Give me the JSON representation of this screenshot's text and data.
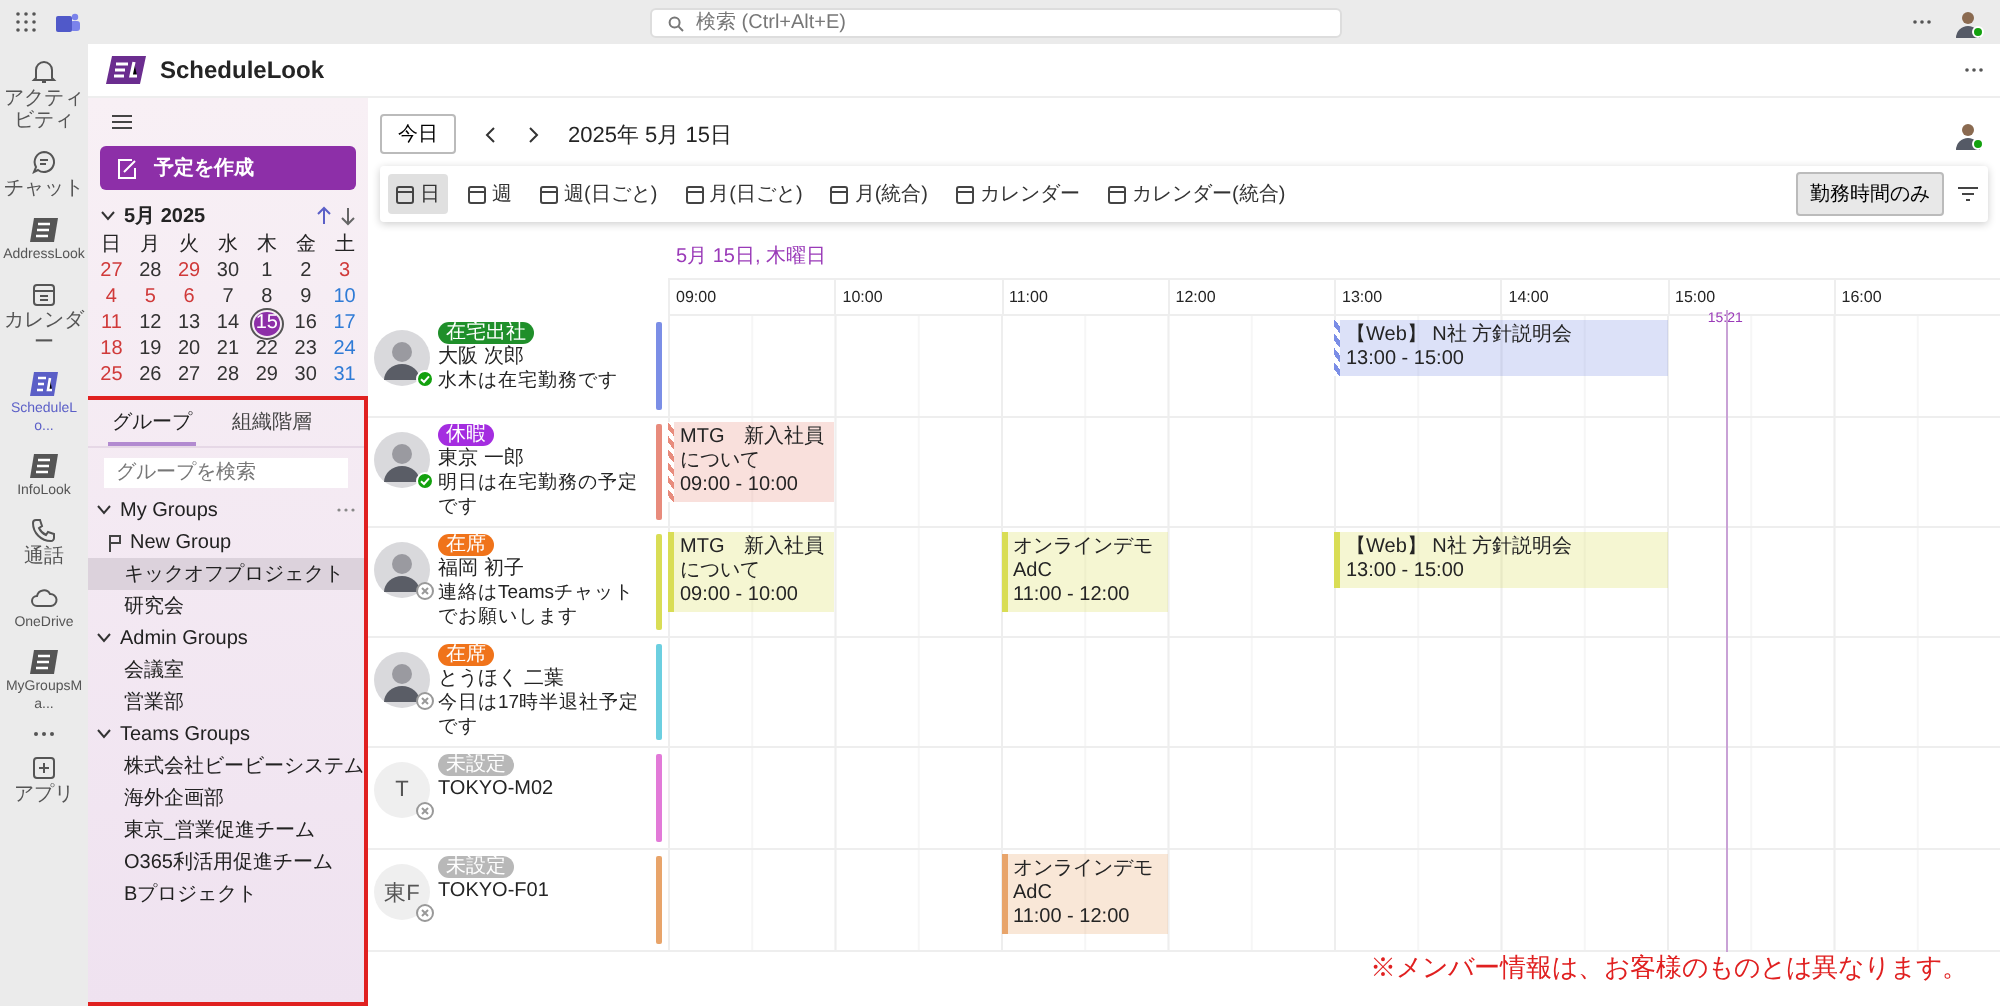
{
  "top_bar": {
    "search": {
      "placeholder": "検索 (Ctrl+Alt+E)"
    }
  },
  "app_rail": [
    {
      "label": "アクティビティ",
      "kind": "bell",
      "selected": false
    },
    {
      "label": "チャット",
      "kind": "chat",
      "selected": false
    },
    {
      "label": "AddressLook",
      "kind": "addresslook",
      "selected": false
    },
    {
      "label": "カレンダー",
      "kind": "calendar",
      "selected": false
    },
    {
      "label": "ScheduleLo...",
      "kind": "schedulelook",
      "selected": true
    },
    {
      "label": "InfoLook",
      "kind": "infolook",
      "selected": false
    },
    {
      "label": "通話",
      "kind": "phone",
      "selected": false
    },
    {
      "label": "OneDrive",
      "kind": "cloud",
      "selected": false
    },
    {
      "label": "MyGroupsMa...",
      "kind": "mygroups",
      "selected": false
    },
    {
      "kind": "more",
      "selected": false
    },
    {
      "label": "アプリ",
      "kind": "apps",
      "selected": false
    }
  ],
  "app": {
    "name": "ScheduleLook"
  },
  "sidebar": {
    "create_button": "予定を作成",
    "mini_calendar": {
      "title": "5月 2025",
      "weekdays": [
        "日",
        "月",
        "火",
        "水",
        "木",
        "金",
        "土"
      ],
      "weeks": [
        [
          {
            "day": "27",
            "kind": "sunday",
            "selected": false
          },
          {
            "day": "28",
            "kind": "weekday",
            "selected": false
          },
          {
            "day": "29",
            "kind": "holiday",
            "selected": false
          },
          {
            "day": "30",
            "kind": "weekday",
            "selected": false
          },
          {
            "day": "1",
            "kind": "weekday",
            "selected": false
          },
          {
            "day": "2",
            "kind": "weekday",
            "selected": false
          },
          {
            "day": "3",
            "kind": "holiday",
            "selected": false
          }
        ],
        [
          {
            "day": "4",
            "kind": "sunday",
            "selected": false
          },
          {
            "day": "5",
            "kind": "holiday",
            "selected": false
          },
          {
            "day": "6",
            "kind": "holiday",
            "selected": false
          },
          {
            "day": "7",
            "kind": "weekday",
            "selected": false
          },
          {
            "day": "8",
            "kind": "weekday",
            "selected": false
          },
          {
            "day": "9",
            "kind": "weekday",
            "selected": false
          },
          {
            "day": "10",
            "kind": "saturday",
            "selected": false
          }
        ],
        [
          {
            "day": "11",
            "kind": "sunday",
            "selected": false
          },
          {
            "day": "12",
            "kind": "weekday",
            "selected": false
          },
          {
            "day": "13",
            "kind": "weekday",
            "selected": false
          },
          {
            "day": "14",
            "kind": "weekday",
            "selected": false
          },
          {
            "day": "15",
            "kind": "weekday",
            "selected": true
          },
          {
            "day": "16",
            "kind": "weekday",
            "selected": false
          },
          {
            "day": "17",
            "kind": "saturday",
            "selected": false
          }
        ],
        [
          {
            "day": "18",
            "kind": "sunday",
            "selected": false
          },
          {
            "day": "19",
            "kind": "weekday",
            "selected": false
          },
          {
            "day": "20",
            "kind": "weekday",
            "selected": false
          },
          {
            "day": "21",
            "kind": "weekday",
            "selected": false
          },
          {
            "day": "22",
            "kind": "weekday",
            "selected": false
          },
          {
            "day": "23",
            "kind": "weekday",
            "selected": false
          },
          {
            "day": "24",
            "kind": "saturday",
            "selected": false
          }
        ],
        [
          {
            "day": "25",
            "kind": "sunday",
            "selected": false
          },
          {
            "day": "26",
            "kind": "weekday",
            "selected": false
          },
          {
            "day": "27",
            "kind": "weekday",
            "selected": false
          },
          {
            "day": "28",
            "kind": "weekday",
            "selected": false
          },
          {
            "day": "29",
            "kind": "weekday",
            "selected": false
          },
          {
            "day": "30",
            "kind": "weekday",
            "selected": false
          },
          {
            "day": "31",
            "kind": "saturday",
            "selected": false
          }
        ]
      ]
    },
    "tabs": [
      {
        "label": "グループ",
        "selected": true
      },
      {
        "label": "組織階層",
        "selected": false
      }
    ],
    "search": {
      "placeholder": "グループを検索"
    },
    "groups": [
      {
        "label": "My Groups",
        "expanded": true,
        "children": [
          {
            "label": "New Group",
            "kind": "new",
            "selected": false
          },
          {
            "label": "キックオフプロジェクト",
            "kind": "group",
            "selected": true
          },
          {
            "label": "研究会",
            "kind": "group",
            "selected": false
          }
        ]
      },
      {
        "label": "Admin Groups",
        "expanded": true,
        "children": [
          {
            "label": "会議室",
            "kind": "group",
            "selected": false
          },
          {
            "label": "営業部",
            "kind": "group",
            "selected": false
          }
        ]
      },
      {
        "label": "Teams Groups",
        "expanded": true,
        "children": [
          {
            "label": "株式会社ビービーシステム",
            "kind": "group",
            "selected": false
          },
          {
            "label": "海外企画部",
            "kind": "group",
            "selected": false
          },
          {
            "label": "東京_営業促進チーム",
            "kind": "group",
            "selected": false
          },
          {
            "label": "O365利活用促進チーム",
            "kind": "group",
            "selected": false
          },
          {
            "label": "Bプロジェクト",
            "kind": "group",
            "selected": false
          }
        ]
      }
    ]
  },
  "toolbar": {
    "today_button": "今日",
    "date": "2025年 5月 15日"
  },
  "views": [
    {
      "label": "日",
      "selected": true
    },
    {
      "label": "週",
      "selected": false
    },
    {
      "label": "週(日ごと)",
      "selected": false
    },
    {
      "label": "月(日ごと)",
      "selected": false
    },
    {
      "label": "月(統合)",
      "selected": false
    },
    {
      "label": "カレンダー",
      "selected": false
    },
    {
      "label": "カレンダー(統合)",
      "selected": false
    }
  ],
  "work_hours_button": "勤務時間のみ",
  "schedule": {
    "date_heading": "5月 15日, 木曜日",
    "hours": [
      "09:00",
      "10:00",
      "11:00",
      "12:00",
      "13:00",
      "14:00",
      "15:00",
      "16:00"
    ],
    "current_time": "15:21",
    "members": [
      {
        "name": "大阪 次郎",
        "status": {
          "label": "在宅出社",
          "color": "#1f8f2a"
        },
        "message": "水木は在宅勤務です",
        "available": true,
        "color": "#7b8ee6",
        "events": [
          {
            "title": "【Web】 N社 方針説明会",
            "time": "13:00 - 15:00",
            "tentative": true
          }
        ]
      },
      {
        "name": "東京 一郎",
        "status": {
          "label": "休暇",
          "color": "#a42de0"
        },
        "message": "明日は在宅勤務の予定です",
        "available": true,
        "color": "#e88b7c",
        "events": [
          {
            "title": "MTG　新入社員について",
            "time": "09:00 - 10:00",
            "tentative": true
          }
        ]
      },
      {
        "name": "福岡 初子",
        "status": {
          "label": "在席",
          "color": "#f0731a"
        },
        "message": "連絡はTeamsチャットでお願いします",
        "available": false,
        "color": "#d9dd55",
        "events": [
          {
            "title": "MTG　新入社員について",
            "time": "09:00 - 10:00",
            "tentative": false
          },
          {
            "title": "オンラインデモ　AdC",
            "time": "11:00 - 12:00",
            "tentative": false
          },
          {
            "title": "【Web】 N社 方針説明会",
            "time": "13:00 - 15:00",
            "tentative": false
          }
        ]
      },
      {
        "name": "とうほく 二葉",
        "status": {
          "label": "在席",
          "color": "#f0731a"
        },
        "message": "今日は17時半退社予定です",
        "available": false,
        "color": "#6ccfe0"
      },
      {
        "name": "TOKYO-M02",
        "status": {
          "label": "未設定",
          "color": "#b8b8b8"
        },
        "initials": "T",
        "available": false,
        "color": "#e27ad8"
      },
      {
        "name": "TOKYO-F01",
        "status": {
          "label": "未設定",
          "color": "#b8b8b8"
        },
        "initials": "東F",
        "available": false,
        "color": "#e8a46a",
        "events": [
          {
            "title": "オンラインデモ　AdC",
            "time": "11:00 - 12:00",
            "tentative": false
          }
        ]
      }
    ]
  },
  "note": "※メンバー情報は、お客様のものとは異なります。"
}
